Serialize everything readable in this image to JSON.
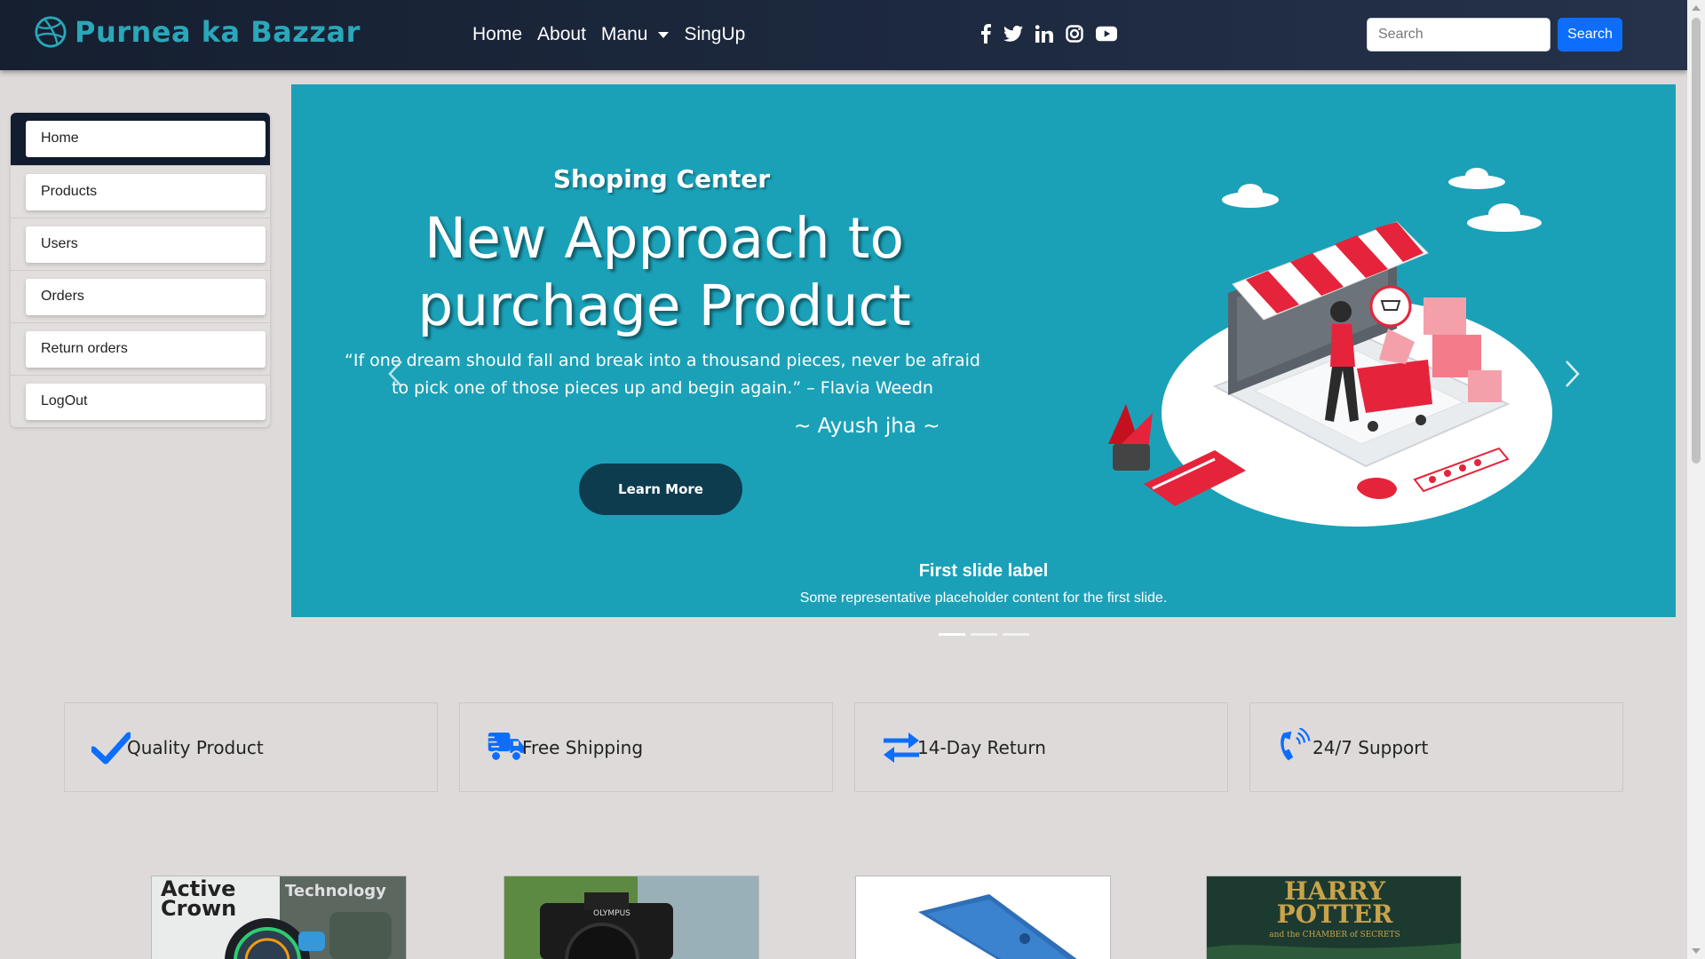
{
  "brand": {
    "name": "Purnea ka Bazzar",
    "icon": "dribbble-icon"
  },
  "nav": {
    "links": [
      "Home",
      "About",
      "Manu",
      "SingUp"
    ],
    "socials": [
      "facebook-icon",
      "twitter-icon",
      "linkedin-icon",
      "instagram-icon",
      "youtube-icon"
    ],
    "search_placeholder": "Search",
    "search_button": "Search"
  },
  "sidebar": {
    "items": [
      {
        "label": "Home",
        "active": true
      },
      {
        "label": "Products"
      },
      {
        "label": "Users"
      },
      {
        "label": "Orders"
      },
      {
        "label": "Return orders"
      },
      {
        "label": "LogOut"
      }
    ]
  },
  "carousel": {
    "kicker": "Shoping Center",
    "title_line1": "New Approach to",
    "title_line2": "purchage Product",
    "quote": "“If one dream should fall and break into a thousand pieces, never be afraid to pick one of those pieces up and begin again.” – Flavia Weedn",
    "author": "~ Ayush jha ~",
    "cta": "Learn More",
    "caption_title": "First slide label",
    "caption_text": "Some representative placeholder content for the first slide.",
    "slides_count": 3,
    "active_slide": 1
  },
  "features": [
    {
      "label": "Quality Product",
      "icon": "check-icon"
    },
    {
      "label": "Free Shipping",
      "icon": "truck-icon"
    },
    {
      "label": "14-Day Return",
      "icon": "exchange-arrows-icon"
    },
    {
      "label": "24/7 Support",
      "icon": "phone-volume-icon"
    }
  ],
  "products": [
    {
      "image_text_1": "Active",
      "image_text_2": "Crown",
      "image_text_3": "Technology"
    },
    {
      "image_text_1": "OLYMPUS"
    },
    {
      "image_text_1": ""
    },
    {
      "image_text_1": "HARRY",
      "image_text_2": "POTTER",
      "image_text_3": "and the CHAMBER of SECRETS"
    }
  ],
  "colors": {
    "nav_bg": "#151f30",
    "brand": "#2aa7b9",
    "carousel_bg": "#1aa1b8",
    "primary": "#0d6efd",
    "cta_bg": "#0e3c4f",
    "page_bg": "#dedad9"
  }
}
